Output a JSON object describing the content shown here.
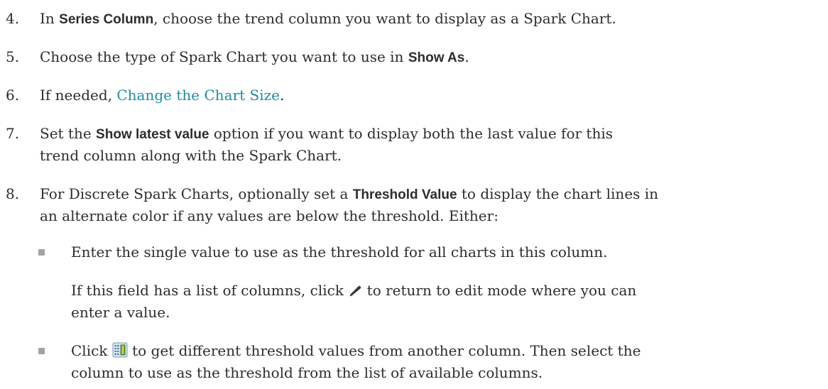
{
  "steps": [
    {
      "num": "4.",
      "t1": "In ",
      "b": "Series Column",
      "t2": ", choose the trend column you want to display as a Spark Chart."
    },
    {
      "num": "5.",
      "t1": "Choose the type of Spark Chart you want to use in ",
      "b": "Show As",
      "t2": "."
    },
    {
      "num": "6.",
      "t1": "If needed, ",
      "link": "Change the Chart Size",
      "t2": "."
    },
    {
      "num": "7.",
      "t1": "Set the ",
      "b": "Show latest value",
      "t2": " option if you want to display both the last value for this",
      "line2": "trend column along with the Spark Chart."
    },
    {
      "num": "8.",
      "t1": "For Discrete Spark Charts, optionally set a ",
      "b": "Threshold Value",
      "t2": " to display the chart lines in",
      "line2": "an alternate color if any values are below the threshold. Either:"
    }
  ],
  "bullets": [
    {
      "line1": "Enter the single value to use as the threshold for all charts in this column.",
      "para_a": "If this field has a list of columns, click ",
      "para_b": " to return to edit mode where you can",
      "para_c": "enter a value."
    },
    {
      "t1": "Click ",
      "t2": " to get different threshold values from another column. Then select the",
      "line2": "column to use as the threshold from the list of available columns."
    }
  ],
  "icons": {
    "edit": "pencil-icon",
    "column_picker": "column-list-icon"
  },
  "colors": {
    "link": "#1d8ea2",
    "text": "#2d2d2d",
    "bullet": "#a3a3a3"
  }
}
